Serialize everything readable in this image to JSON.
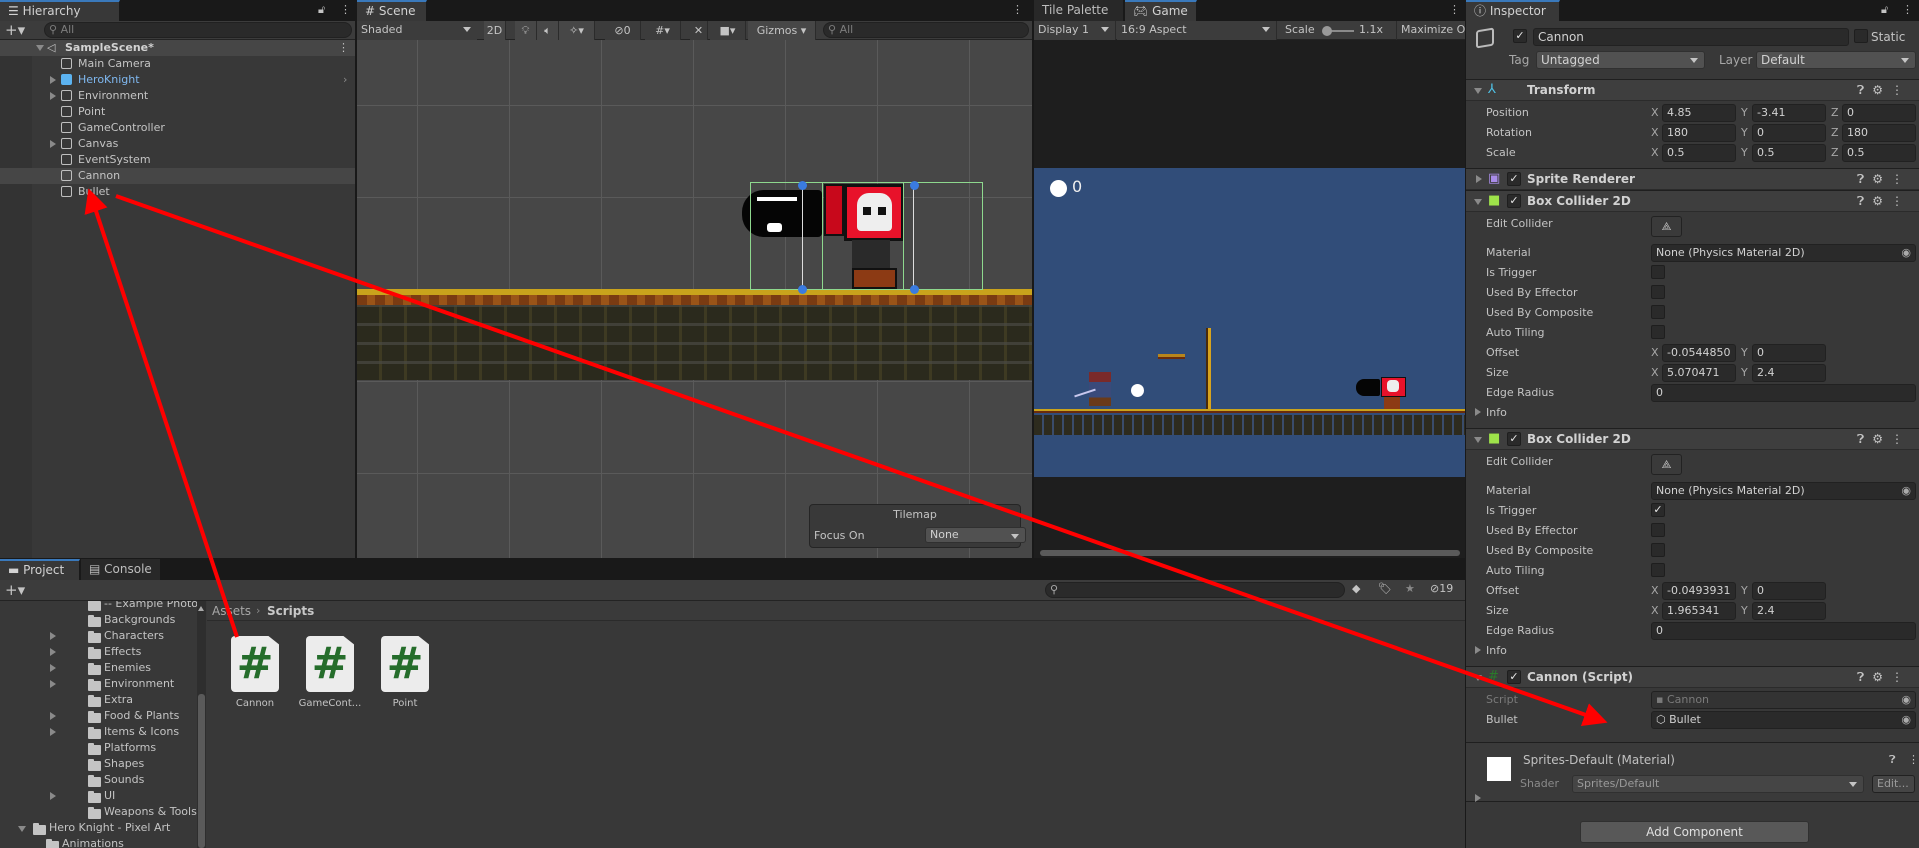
{
  "hierarchy": {
    "tab": "Hierarchy",
    "search_placeholder": "All",
    "scene_name": "SampleScene*",
    "items": [
      {
        "label": "Main Camera",
        "expandable": false,
        "prefab": false
      },
      {
        "label": "HeroKnight",
        "expandable": true,
        "prefab": true
      },
      {
        "label": "Environment",
        "expandable": true,
        "prefab": false
      },
      {
        "label": "Point",
        "expandable": false,
        "prefab": false
      },
      {
        "label": "GameController",
        "expandable": false,
        "prefab": false
      },
      {
        "label": "Canvas",
        "expandable": true,
        "prefab": false
      },
      {
        "label": "EventSystem",
        "expandable": false,
        "prefab": false
      },
      {
        "label": "Cannon",
        "expandable": false,
        "prefab": false,
        "selected": true
      },
      {
        "label": "Bullet",
        "expandable": false,
        "prefab": false
      }
    ]
  },
  "scene": {
    "tab": "Scene",
    "shading": "Shaded",
    "mode_2d": "2D",
    "hidden_count": "0",
    "gizmos": "Gizmos",
    "search_placeholder": "All",
    "overlay": {
      "title": "Tilemap",
      "focus_label": "Focus On",
      "focus_value": "None"
    }
  },
  "game": {
    "tabs": [
      "Tile Palette",
      "Game"
    ],
    "display": "Display 1",
    "aspect": "16:9 Aspect",
    "scale_label": "Scale",
    "scale_value": "1.1x",
    "scale_fraction": 0.1,
    "maximize": "Maximize O",
    "hud_score": "0",
    "sky_color": "#314d79"
  },
  "inspector": {
    "tab": "Inspector",
    "object_name": "Cannon",
    "active": true,
    "static_label": "Static",
    "tag_label": "Tag",
    "tag_value": "Untagged",
    "layer_label": "Layer",
    "layer_value": "Default",
    "components": [
      {
        "title": "Transform",
        "icon": "transform-icon",
        "expanded": true,
        "has_checkbox": false,
        "rows": [
          {
            "type": "vec3",
            "label": "Position",
            "values": [
              "4.85",
              "-3.41",
              "0"
            ]
          },
          {
            "type": "vec3",
            "label": "Rotation",
            "values": [
              "180",
              "0",
              "180"
            ]
          },
          {
            "type": "vec3",
            "label": "Scale",
            "values": [
              "0.5",
              "0.5",
              "0.5"
            ]
          }
        ]
      },
      {
        "title": "Sprite Renderer",
        "icon": "sprite-renderer-icon",
        "expanded": false,
        "has_checkbox": true,
        "enabled": true,
        "rows": []
      },
      {
        "title": "Box Collider 2D",
        "icon": "box-collider-icon",
        "expanded": true,
        "has_checkbox": true,
        "enabled": true,
        "rows": [
          {
            "type": "button",
            "label": "Edit Collider"
          },
          {
            "type": "object",
            "label": "Material",
            "value": "None (Physics Material 2D)"
          },
          {
            "type": "bool",
            "label": "Is Trigger",
            "value": false
          },
          {
            "type": "bool",
            "label": "Used By Effector",
            "value": false
          },
          {
            "type": "bool",
            "label": "Used By Composite",
            "value": false
          },
          {
            "type": "bool",
            "label": "Auto Tiling",
            "value": false
          },
          {
            "type": "vec2",
            "label": "Offset",
            "values": [
              "-0.0544850",
              "0"
            ]
          },
          {
            "type": "vec2",
            "label": "Size",
            "values": [
              "5.070471",
              "2.4"
            ]
          },
          {
            "type": "float",
            "label": "Edge Radius",
            "value": "0"
          },
          {
            "type": "foldout",
            "label": "Info"
          }
        ]
      },
      {
        "title": "Box Collider 2D",
        "icon": "box-collider-icon",
        "expanded": true,
        "has_checkbox": true,
        "enabled": true,
        "rows": [
          {
            "type": "button",
            "label": "Edit Collider"
          },
          {
            "type": "object",
            "label": "Material",
            "value": "None (Physics Material 2D)"
          },
          {
            "type": "bool",
            "label": "Is Trigger",
            "value": true
          },
          {
            "type": "bool",
            "label": "Used By Effector",
            "value": false
          },
          {
            "type": "bool",
            "label": "Used By Composite",
            "value": false
          },
          {
            "type": "bool",
            "label": "Auto Tiling",
            "value": false
          },
          {
            "type": "vec2",
            "label": "Offset",
            "values": [
              "-0.0493931",
              "0"
            ]
          },
          {
            "type": "vec2",
            "label": "Size",
            "values": [
              "1.965341",
              "2.4"
            ]
          },
          {
            "type": "float",
            "label": "Edge Radius",
            "value": "0"
          },
          {
            "type": "foldout",
            "label": "Info"
          }
        ]
      },
      {
        "title": "Cannon (Script)",
        "icon": "script-icon",
        "expanded": true,
        "has_checkbox": true,
        "enabled": true,
        "rows": [
          {
            "type": "object",
            "label": "Script",
            "value": "Cannon",
            "disabled": true,
            "obj_icon": "script"
          },
          {
            "type": "object",
            "label": "Bullet",
            "value": "Bullet",
            "obj_icon": "prefab"
          }
        ]
      }
    ],
    "material": {
      "name": "Sprites-Default (Material)",
      "shader_label": "Shader",
      "shader_value": "Sprites/Default",
      "edit": "Edit..."
    },
    "add_component": "Add Component"
  },
  "project": {
    "tabs": [
      "Project",
      "Console"
    ],
    "hidden_count": "19",
    "tree": [
      {
        "label": "-- Example Photos --",
        "expandable": false,
        "level": 2
      },
      {
        "label": "Backgrounds",
        "expandable": false,
        "level": 2
      },
      {
        "label": "Characters",
        "expandable": true,
        "level": 2
      },
      {
        "label": "Effects",
        "expandable": true,
        "level": 2
      },
      {
        "label": "Enemies",
        "expandable": true,
        "level": 2
      },
      {
        "label": "Environment",
        "expandable": true,
        "level": 2
      },
      {
        "label": "Extra",
        "expandable": false,
        "level": 2
      },
      {
        "label": "Food & Plants",
        "expandable": true,
        "level": 2
      },
      {
        "label": "Items & Icons",
        "expandable": true,
        "level": 2
      },
      {
        "label": "Platforms",
        "expandable": false,
        "level": 2
      },
      {
        "label": "Shapes",
        "expandable": false,
        "level": 2
      },
      {
        "label": "Sounds",
        "expandable": false,
        "level": 2
      },
      {
        "label": "UI",
        "expandable": true,
        "level": 2
      },
      {
        "label": "Weapons & Tools",
        "expandable": false,
        "level": 2
      },
      {
        "label": "Hero Knight - Pixel Art",
        "expandable": true,
        "expanded": true,
        "level": 1
      },
      {
        "label": "Animations",
        "expandable": false,
        "level": 2
      }
    ],
    "breadcrumb": [
      "Assets",
      "Scripts"
    ],
    "assets": [
      "Cannon",
      "GameCont...",
      "Point"
    ]
  }
}
